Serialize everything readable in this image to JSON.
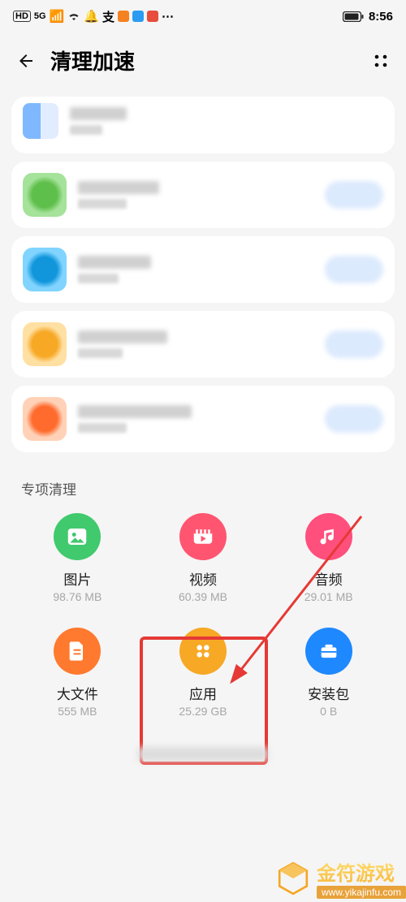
{
  "status": {
    "time": "8:56",
    "network": "5G",
    "hd": "HD"
  },
  "header": {
    "title": "清理加速"
  },
  "section": {
    "title": "专项清理"
  },
  "tiles": [
    {
      "name": "图片",
      "size": "98.76 MB",
      "color": "#41c96e",
      "icon": "image"
    },
    {
      "name": "视频",
      "size": "60.39 MB",
      "color": "#ff5570",
      "icon": "video"
    },
    {
      "name": "音频",
      "size": "29.01 MB",
      "color": "#ff4f7d",
      "icon": "audio"
    },
    {
      "name": "大文件",
      "size": "555 MB",
      "color": "#ff7a2e",
      "icon": "file"
    },
    {
      "name": "应用",
      "size": "25.29 GB",
      "color": "#f7a825",
      "icon": "apps"
    },
    {
      "name": "安装包",
      "size": "0 B",
      "color": "#1e88ff",
      "icon": "pkg"
    }
  ],
  "watermark": {
    "brand": "金符游戏",
    "url": "www.yikajinfu.com"
  }
}
